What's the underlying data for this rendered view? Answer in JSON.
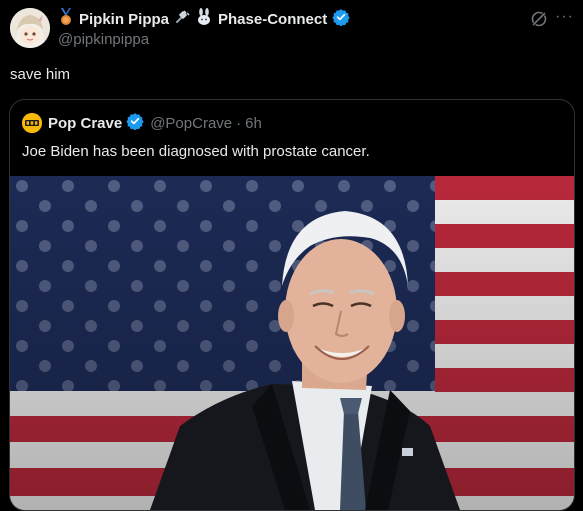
{
  "post": {
    "display_name": "Pipkin Pippa",
    "affiliation": "Phase-Connect",
    "handle": "@pipkinpippa",
    "text": "save him"
  },
  "quoted": {
    "display_name": "Pop Crave",
    "handle": "@PopCrave",
    "separator": "·",
    "time": "6h",
    "text": "Joe Biden has been diagnosed with prostate cancer."
  },
  "icons": {
    "badge": "medal-icon",
    "plug": "plug-icon",
    "bunny": "rabbit-icon",
    "verified": "verified-badge-icon",
    "grok": "grok-icon",
    "more": "more-icon"
  },
  "colors": {
    "background": "#000000",
    "text": "#e7e9ea",
    "muted": "#71767b",
    "verified": "#1d9bf0",
    "border": "#2f3336"
  }
}
